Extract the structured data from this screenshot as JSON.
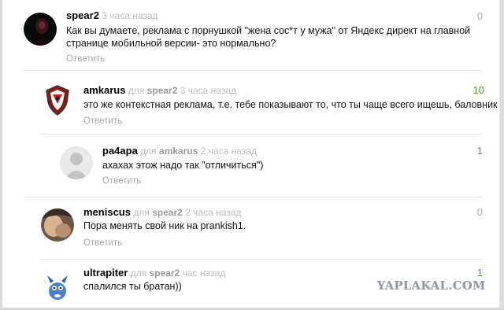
{
  "comments": [
    {
      "author": "spear2",
      "reply_prefix": "",
      "reply_to": "",
      "time": "3 часа назад",
      "rating": "0",
      "rating_color": "#aaaaaa",
      "text_lines": [
        "Как вы думаете, реклама с порнушкой \"жена сос*т у мужа\" от Яндекс директ на главной",
        "странице мобильной версии- это нормально?"
      ],
      "reply_label": "Ответить",
      "avatar_icon": "dark-portrait-avatar"
    },
    {
      "author": "amkarus",
      "reply_prefix": "для",
      "reply_to": "spear2",
      "time": "3 часа назад",
      "rating": "10",
      "rating_color": "#5aa01e",
      "text_lines": [
        "это же контекстная реклама, т.е. тебе показывают то, что ты чаще всего ищешь, баловник"
      ],
      "reply_label": "Ответить",
      "avatar_icon": "shield-emblem-avatar"
    },
    {
      "author": "pa4apa",
      "reply_prefix": "для",
      "reply_to": "amkarus",
      "time": "2 часа назад",
      "rating": "1",
      "rating_color": "#5aa01e",
      "text_lines": [
        "ахахах этож надо так \"отличиться\")"
      ],
      "reply_label": "Ответить",
      "avatar_icon": "default-user-avatar"
    },
    {
      "author": "meniscus",
      "reply_prefix": "для",
      "reply_to": "spear2",
      "time": "2 часа назад",
      "rating": "0",
      "rating_color": "#aaaaaa",
      "text_lines": [
        "Пора менять свой ник на prankish1."
      ],
      "reply_label": "Ответить",
      "avatar_icon": "photo-avatar"
    },
    {
      "author": "ultrapiter",
      "reply_prefix": "для",
      "reply_to": "spear2",
      "time": "час назад",
      "rating": "1",
      "rating_color": "#5aa01e",
      "text_lines": [
        "спалился ты братан))"
      ],
      "reply_label": "Ответить",
      "avatar_icon": "cartoon-creature-avatar"
    }
  ],
  "watermark": "YAPLAKAL.COM"
}
